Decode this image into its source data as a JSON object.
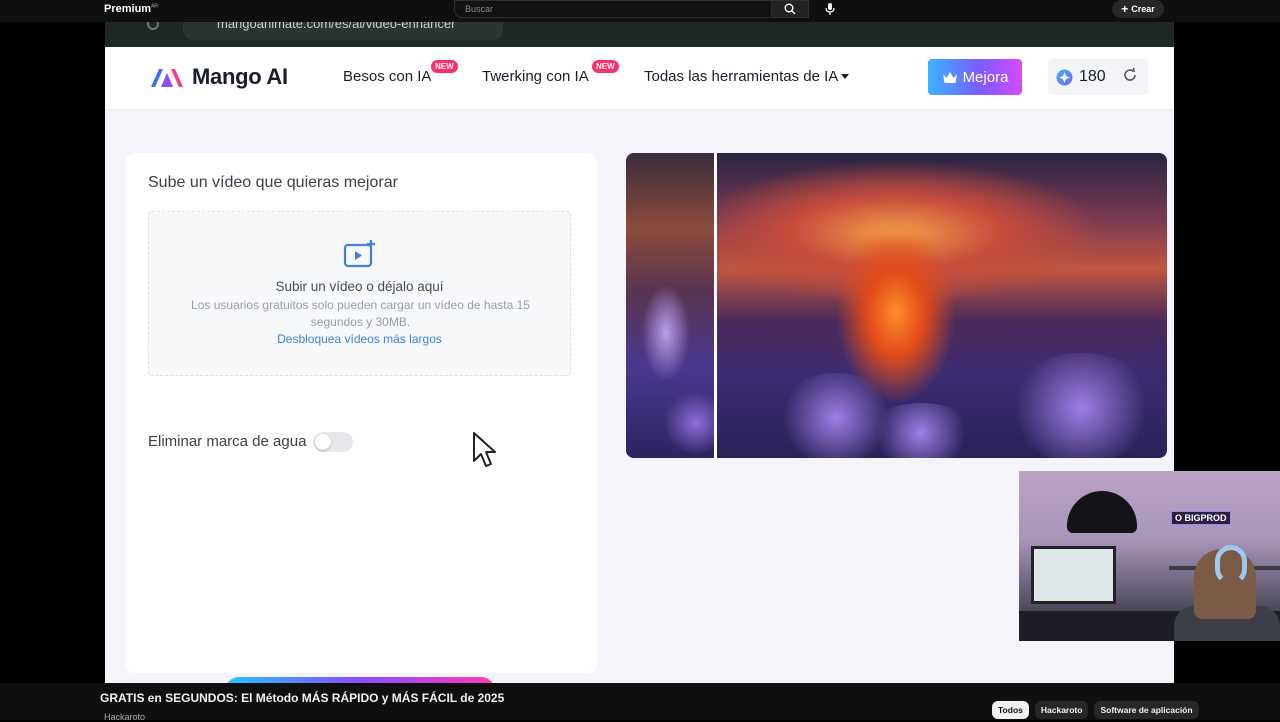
{
  "youtube": {
    "logo": "Premium",
    "logo_region": "AR",
    "search_placeholder": "Buscar",
    "create_label": "Crear",
    "video_title": "GRATIS en SEGUNDOS: El Método MÁS RÁPIDO y MÁS FÁCIL de 2025",
    "channel": "Hackaroto",
    "chips": [
      "Todos",
      "Hackaroto",
      "Software de aplicación"
    ]
  },
  "browser": {
    "url": "mangoanimate.com/es/ai/video-enhancer"
  },
  "site": {
    "logo_text": "Mango AI",
    "nav": [
      {
        "label": "Besos con IA",
        "badge": "NEW"
      },
      {
        "label": "Twerking con IA",
        "badge": "NEW"
      },
      {
        "label": "Todas las herramientas de IA"
      }
    ],
    "upgrade_label": "Mejora",
    "credits": "180"
  },
  "upload": {
    "title": "Sube un vídeo que quieras mejorar",
    "drop_main": "Subir un vídeo o déjalo aquí",
    "drop_sub": "Los usuarios gratuitos solo pueden cargar un vídeo de hasta 15 segundos y 30MB.",
    "drop_link": "Desbloquea vídeos más largos"
  },
  "options": {
    "watermark_label": "Eliminar marca de agua",
    "watermark_on": false
  },
  "webcam": {
    "neon_sign": "O BIGPROD"
  },
  "colors": {
    "accent_gradient_start": "#3bb3ff",
    "accent_gradient_end": "#d54bff",
    "badge_new": "#ff2d6a",
    "link": "#3f82d6"
  }
}
